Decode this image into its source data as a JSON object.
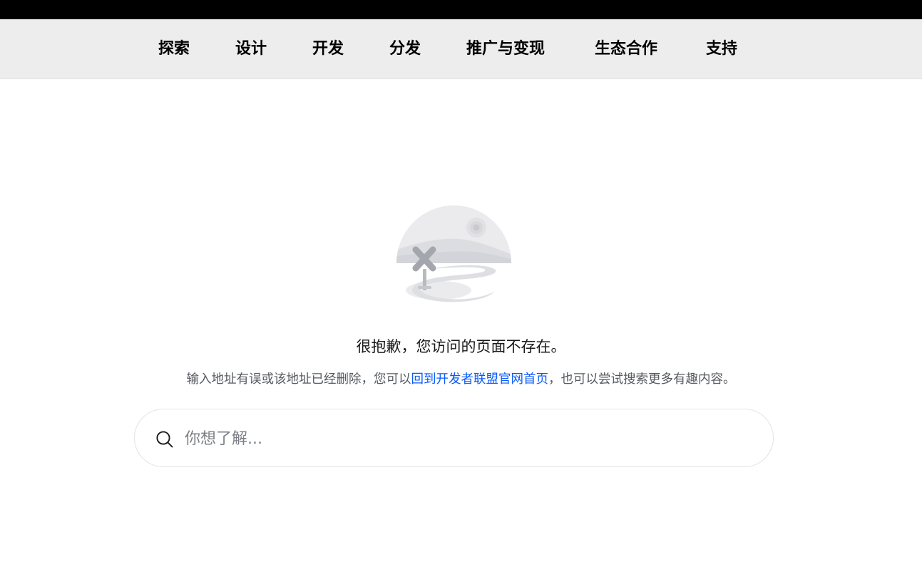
{
  "nav": {
    "items": [
      {
        "label": "探索"
      },
      {
        "label": "设计"
      },
      {
        "label": "开发"
      },
      {
        "label": "分发"
      },
      {
        "label": "推广与变现"
      },
      {
        "label": "生态合作"
      },
      {
        "label": "支持"
      }
    ]
  },
  "error": {
    "title": "很抱歉，您访问的页面不存在。",
    "desc_before": "输入地址有误或该地址已经删除，您可以",
    "home_link": "回到开发者联盟官网首页",
    "desc_after": "，也可以尝试搜索更多有趣内容。"
  },
  "search": {
    "placeholder": "你想了解..."
  },
  "colors": {
    "top_strip": "#000000",
    "nav_background": "#ededee",
    "link": "#0a59f7",
    "muted_text": "#555a60"
  },
  "icons": {
    "search": "search-icon",
    "illustration": "page-not-found-illustration"
  }
}
